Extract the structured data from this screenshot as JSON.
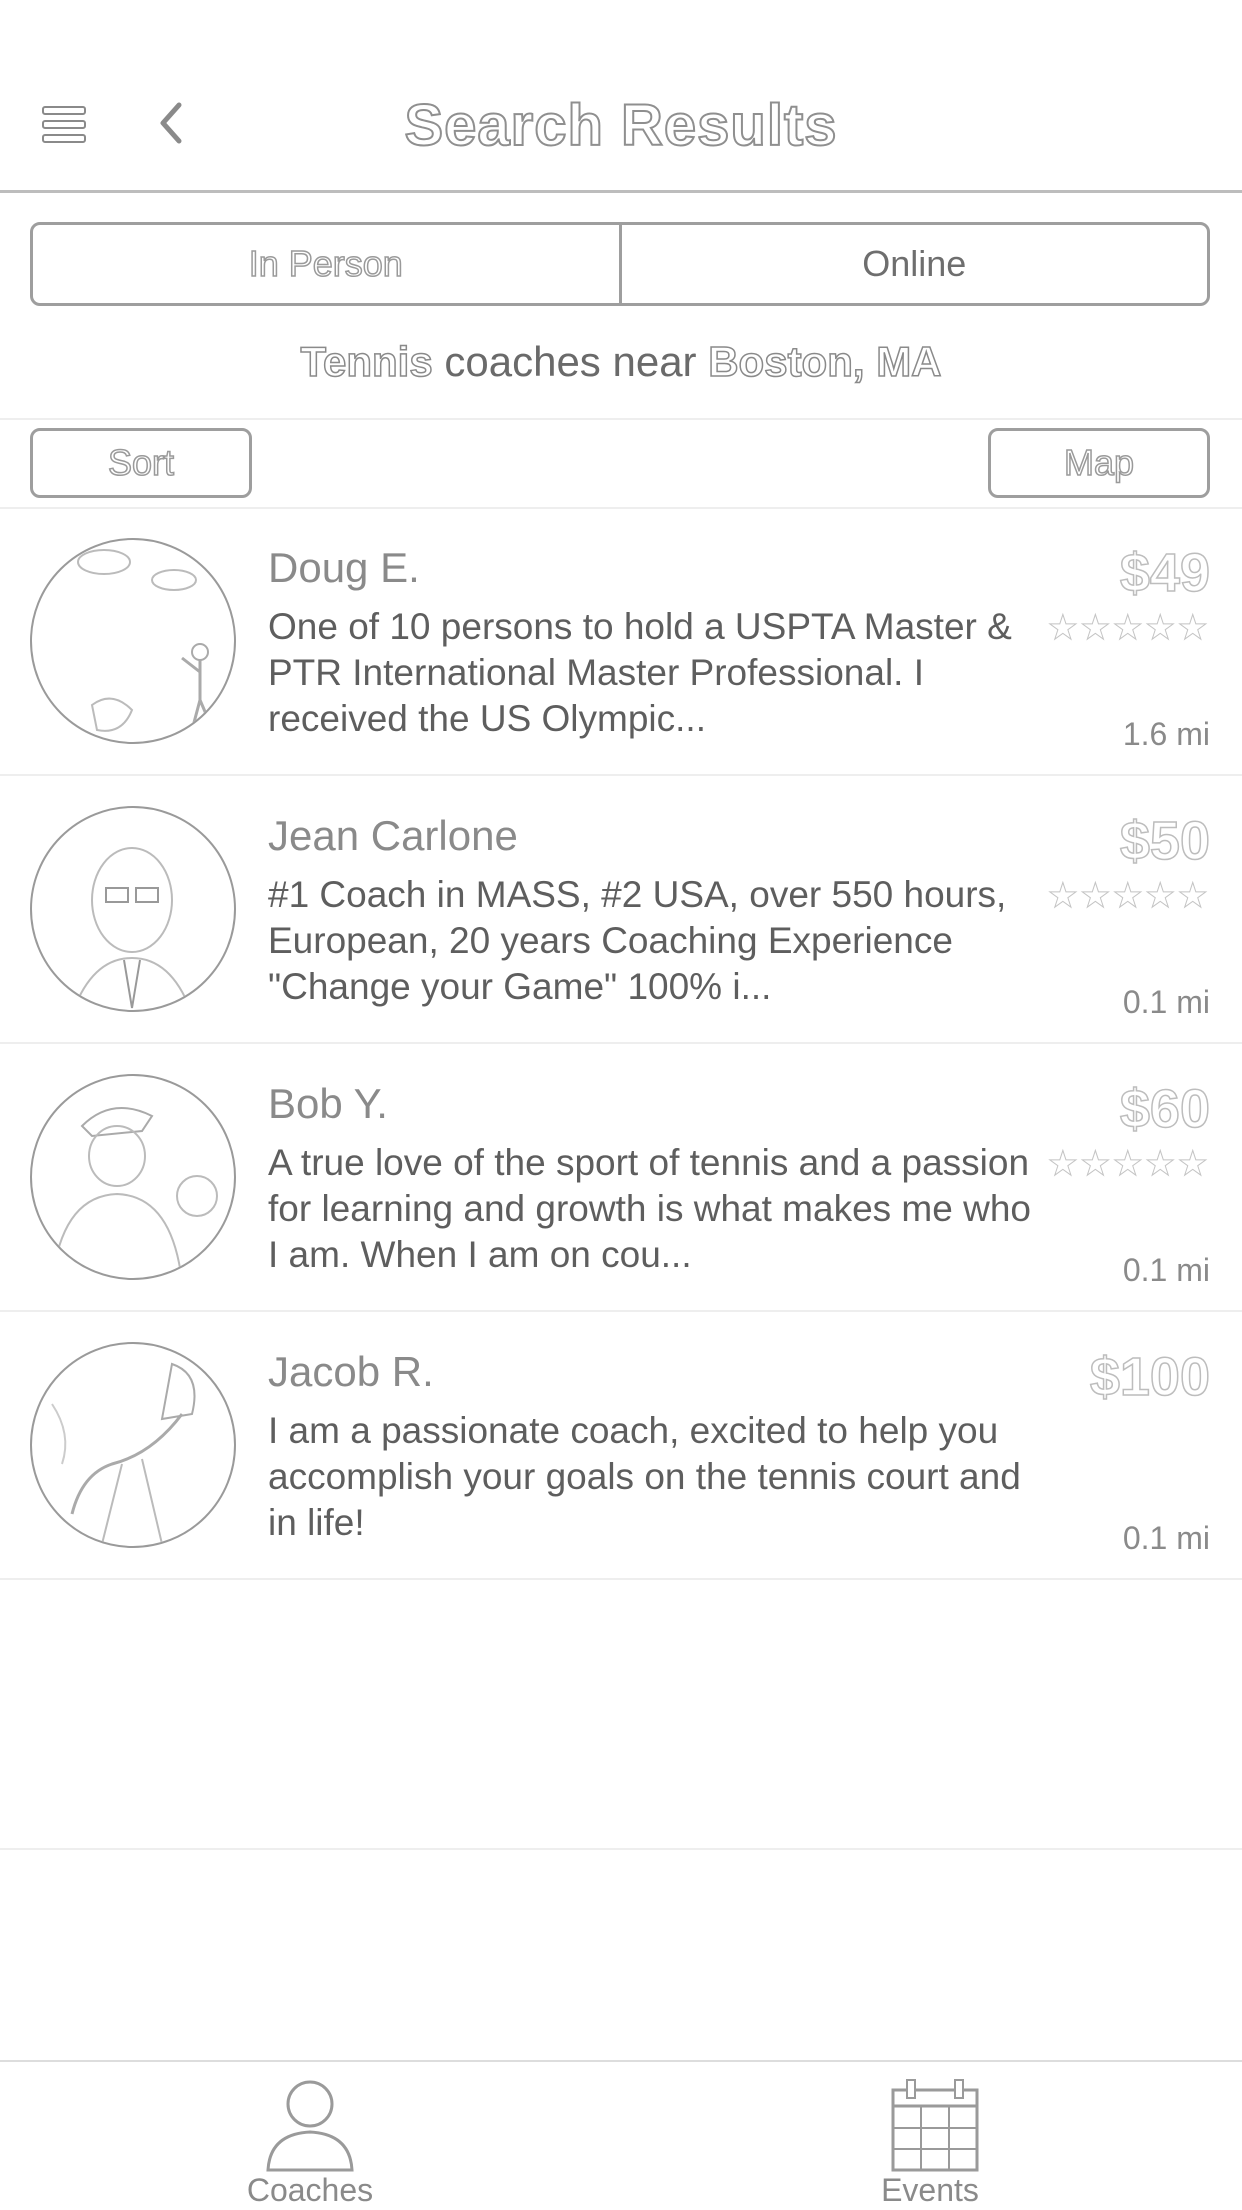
{
  "header": {
    "title": "Search Results"
  },
  "segments": {
    "in_person": "In Person",
    "online": "Online"
  },
  "search": {
    "sport": "Tennis",
    "middle": " coaches near ",
    "location": "Boston, MA"
  },
  "toolbar": {
    "sort_label": "Sort",
    "map_label": "Map"
  },
  "coaches": [
    {
      "name": "Doug E.",
      "bio": "One of 10 persons to hold a USPTA Master & PTR International Master Professional. I received the US Olympic...",
      "price": "$49",
      "stars": "★★★★★",
      "distance": "1.6 mi"
    },
    {
      "name": "Jean Carlone",
      "bio": "#1 Coach in MASS, #2 USA, over 550 hours, European, 20 years Coaching Experience \"Change your Game\" 100% i...",
      "price": "$50",
      "stars": "★★★★★",
      "distance": "0.1 mi"
    },
    {
      "name": "Bob Y.",
      "bio": "A true love of the sport of tennis and a passion for learning and growth is what makes me who I am.  When I am on cou...",
      "price": "$60",
      "stars": "★★★★★",
      "distance": "0.1 mi"
    },
    {
      "name": "Jacob R.",
      "bio": "I am a passionate coach, excited to help you accomplish your goals on the tennis court and in life!",
      "price": "$100",
      "distance": "0.1 mi"
    }
  ],
  "tabs": {
    "coaches_label": "Coaches",
    "events_label": "Events"
  },
  "icons": {
    "menu": "hamburger-menu-icon",
    "back": "chevron-left-icon",
    "coaches": "person-icon",
    "events": "calendar-icon"
  }
}
